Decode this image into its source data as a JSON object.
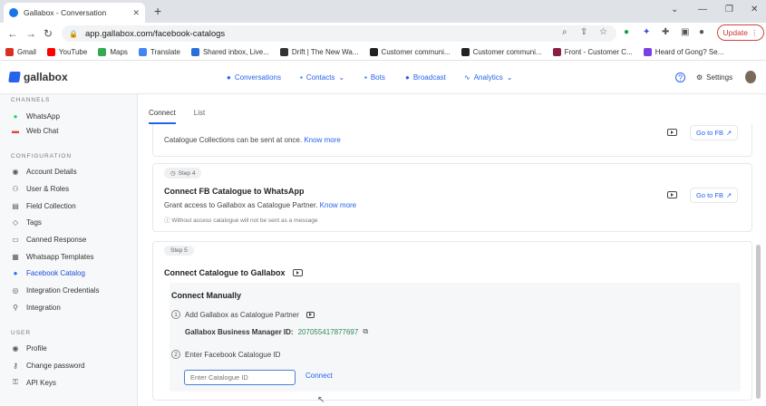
{
  "browser": {
    "tab_title": "Gallabox - Conversation",
    "url": "app.gallabox.com/facebook-catalogs",
    "update_label": "Update",
    "bookmarks": [
      "Gmail",
      "YouTube",
      "Maps",
      "Translate",
      "Shared inbox, Live...",
      "Drift | The New Wa...",
      "Customer communi...",
      "Customer communi...",
      "Front - Customer C...",
      "Heard of Gong? Se..."
    ]
  },
  "app": {
    "logo": "gallabox",
    "nav": [
      "Conversations",
      "Contacts",
      "Bots",
      "Broadcast",
      "Analytics"
    ],
    "settings": "Settings"
  },
  "sidebar": {
    "channels_heading": "CHANNELS",
    "channels": [
      "WhatsApp",
      "Web Chat"
    ],
    "config_heading": "CONFIGURATION",
    "config": [
      "Account Details",
      "User & Roles",
      "Field Collection",
      "Tags",
      "Canned Response",
      "Whatsapp Templates",
      "Facebook Catalog",
      "Integration Credentials",
      "Integration"
    ],
    "user_heading": "USER",
    "user": [
      "Profile",
      "Change password",
      "API Keys"
    ]
  },
  "main": {
    "tabs": [
      "Connect",
      "List"
    ],
    "step3": {
      "text": "Catalogue Collections can be sent at once.",
      "link": "Know more",
      "button": "Go to FB"
    },
    "step4": {
      "pill": "Step 4",
      "title": "Connect FB Catalogue to WhatsApp",
      "text": "Grant access to Gallabox as Catalogue Partner.",
      "link": "Know more",
      "note": "Without access catalogue will not be sent as a message",
      "button": "Go to FB"
    },
    "step5": {
      "pill": "Step 5",
      "title": "Connect Catalogue to Gallabox",
      "manual_title": "Connect Manually",
      "item1": "Add Gallabox as Catalogue Partner",
      "bm_label": "Gallabox Business Manager ID:",
      "bm_id": "207055417877697",
      "item2": "Enter Facebook Catalogue ID",
      "placeholder": "Enter Catalogue ID",
      "connect": "Connect"
    }
  }
}
